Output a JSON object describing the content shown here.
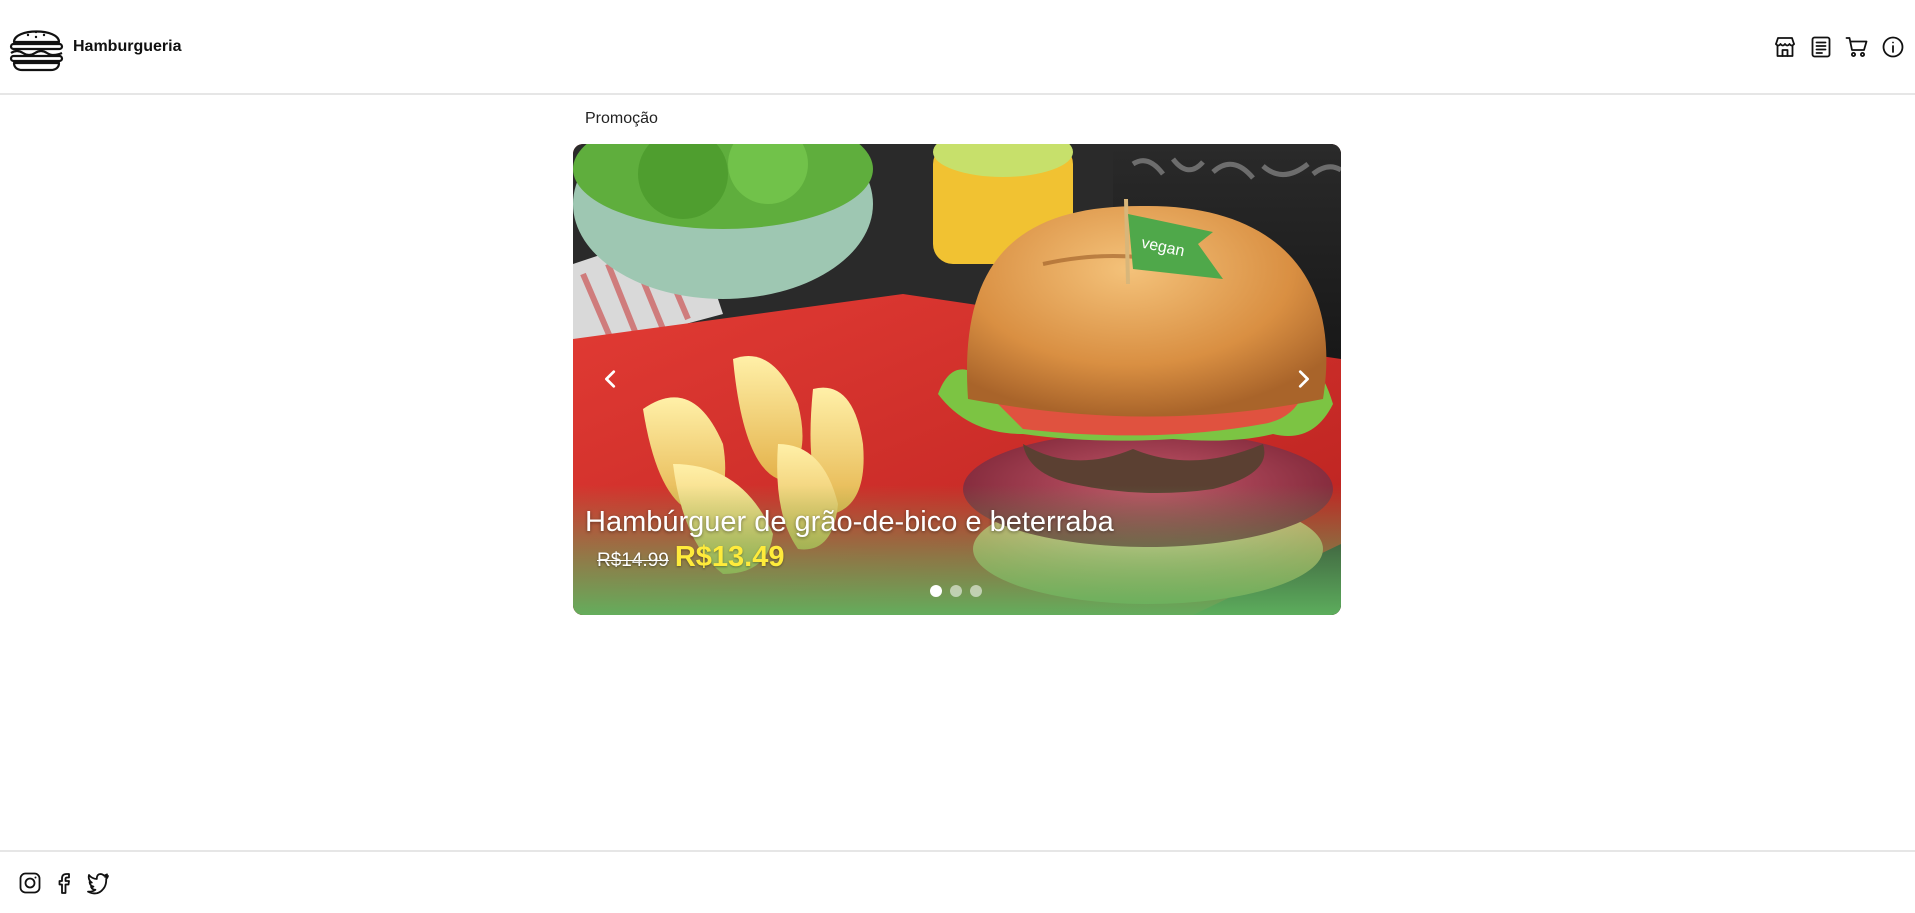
{
  "header": {
    "brand_name": "Hamburgueria",
    "logo_icon": "burger-logo-icon",
    "nav_icons": [
      "store-icon",
      "menu-list-icon",
      "cart-icon",
      "info-icon"
    ]
  },
  "promo": {
    "section_title": "Promoção",
    "slides_count": 3,
    "active_slide": 1,
    "current": {
      "title": "Hambúrguer de grão-de-bico e beterraba",
      "old_price": "R$14.99",
      "new_price": "R$13.49",
      "flag_text": "vegan"
    },
    "prev_icon": "chevron-left-icon",
    "next_icon": "chevron-right-icon"
  },
  "footer": {
    "social_icons": [
      "instagram-icon",
      "facebook-icon",
      "twitter-icon"
    ]
  },
  "colors": {
    "new_price": "#ffeb3b",
    "caption_gradient": "#5fb45f",
    "divider": "#e6e6e6"
  }
}
